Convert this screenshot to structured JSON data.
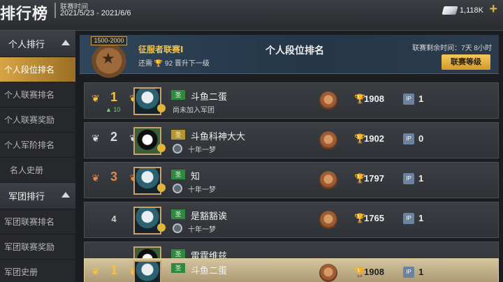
{
  "header": {
    "title": "排行榜",
    "league_time_label": "联赛时间",
    "league_date": "2021/5/23 - 2021/6/6",
    "currency": "1,118K",
    "plus": "+"
  },
  "sidebar": {
    "groups": [
      {
        "label": "个人排行",
        "items": [
          {
            "label": "个人段位排名",
            "active": true
          },
          {
            "label": "个人联赛排名"
          },
          {
            "label": "个人联赛奖励"
          },
          {
            "label": "个人军阶排名"
          },
          {
            "label": "名人史册"
          }
        ]
      },
      {
        "label": "军团排行",
        "items": [
          {
            "label": "军团联赛排名"
          },
          {
            "label": "军团联赛奖励"
          },
          {
            "label": "军团史册"
          }
        ]
      }
    ]
  },
  "banner": {
    "range": "1500-2000",
    "title": "征服者联赛Ⅰ",
    "sub_prefix": "还需",
    "sub_points": "92",
    "sub_suffix": "晋升下一级",
    "center_title": "个人段位排名",
    "remaining_time": "联赛剩余时间：7天 8小时",
    "league_button": "联赛等级"
  },
  "rows": [
    {
      "rank": "1",
      "rank_change": "▲ 10",
      "name": "斗鱼二蛋",
      "guild": "尚未加入军团",
      "guild_none": true,
      "score": "1908",
      "ip": "1"
    },
    {
      "rank": "2",
      "name": "斗鱼科神大大",
      "guild": "十年一梦",
      "score": "1902",
      "ip": "0"
    },
    {
      "rank": "3",
      "name": "知",
      "guild": "十年一梦",
      "score": "1797",
      "ip": "1"
    },
    {
      "rank": "4",
      "name": "是豁豁诶",
      "guild": "十年一梦",
      "score": "1765",
      "ip": "1"
    },
    {
      "rank": "",
      "name": "雷霆维兹",
      "guild": "",
      "score": "",
      "ip": ""
    }
  ],
  "sticky": {
    "rank": "1",
    "name": "斗鱼二蛋",
    "score": "1908",
    "ip": "1"
  },
  "icons": {
    "flag_text": "圣",
    "ip_text": "IP"
  }
}
